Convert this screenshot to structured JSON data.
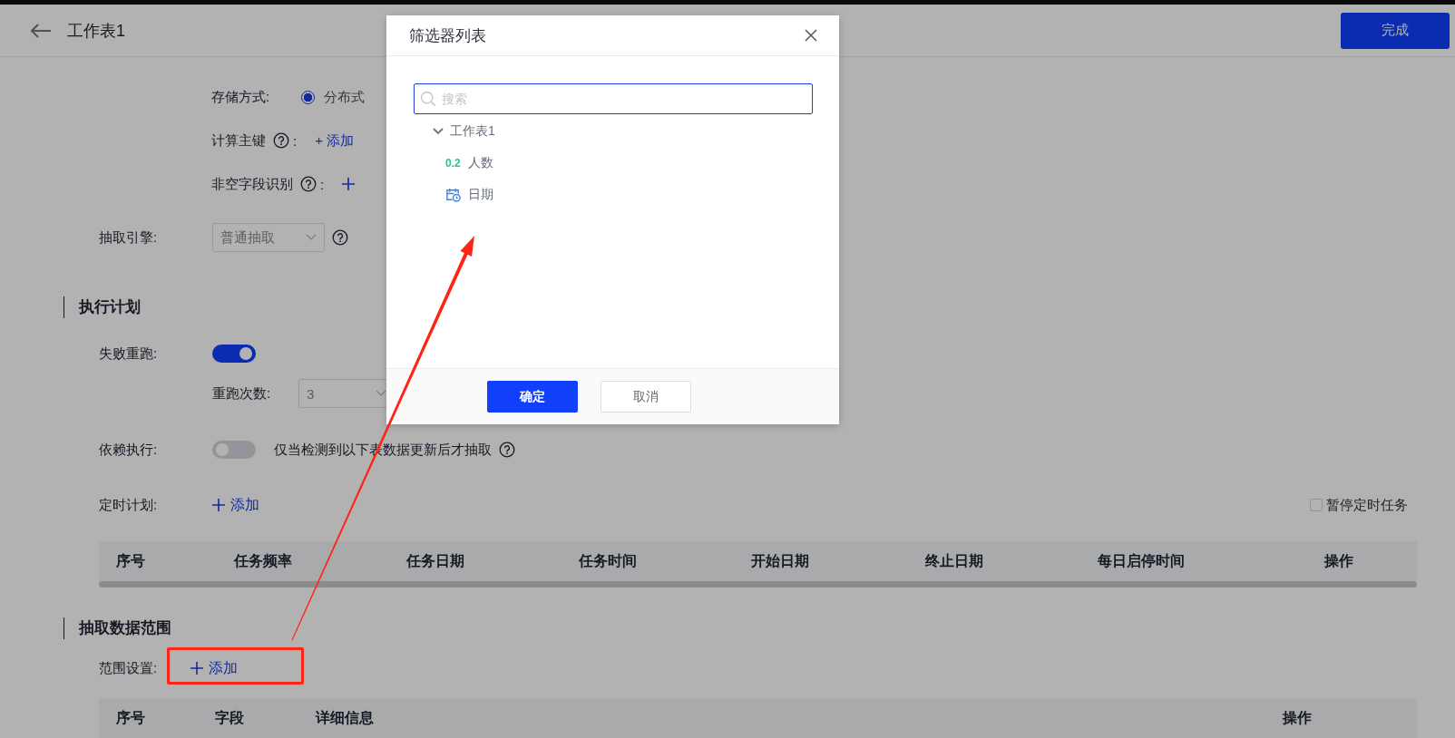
{
  "header": {
    "title": "工作表1",
    "done_button": "完成"
  },
  "storage": {
    "label": "存储方式:",
    "options": [
      {
        "label": "分布式",
        "selected": true
      }
    ]
  },
  "compute_key": {
    "label": "计算主键",
    "colon": ":",
    "action": "+ 添加"
  },
  "non_null": {
    "label": "非空字段识别",
    "colon": ":"
  },
  "engine": {
    "label": "抽取引擎:",
    "value": "普通抽取"
  },
  "plan_section": {
    "title": "执行计划"
  },
  "retry": {
    "label": "失败重跑:",
    "on": true
  },
  "retry_count": {
    "label": "重跑次数:",
    "value": "3"
  },
  "dependency": {
    "label": "依赖执行:",
    "on": false,
    "description": "仅当检测到以下表数据更新后才抽取"
  },
  "schedule": {
    "label": "定时计划:",
    "action": "添加",
    "pause": {
      "label": "暂停定时任务",
      "checked": false
    }
  },
  "schedule_table": {
    "columns": [
      "序号",
      "任务频率",
      "任务日期",
      "任务时间",
      "开始日期",
      "终止日期",
      "每日启停时间",
      "操作"
    ]
  },
  "range_section": {
    "title": "抽取数据范围"
  },
  "range": {
    "label": "范围设置:",
    "action": "添加"
  },
  "range_table": {
    "columns": [
      "序号",
      "字段",
      "详细信息",
      "操作"
    ]
  },
  "dialog": {
    "title": "筛选器列表",
    "search": {
      "placeholder": "搜索"
    },
    "tree": [
      {
        "label": "工作表1",
        "expanded": true,
        "children": [
          {
            "label": "人数",
            "kind": "number",
            "icon_text": "0.2"
          },
          {
            "label": "日期",
            "kind": "date"
          }
        ]
      }
    ],
    "buttons": [
      {
        "label": "确定",
        "kind": "primary"
      },
      {
        "label": "取消",
        "kind": "secondary"
      }
    ]
  }
}
